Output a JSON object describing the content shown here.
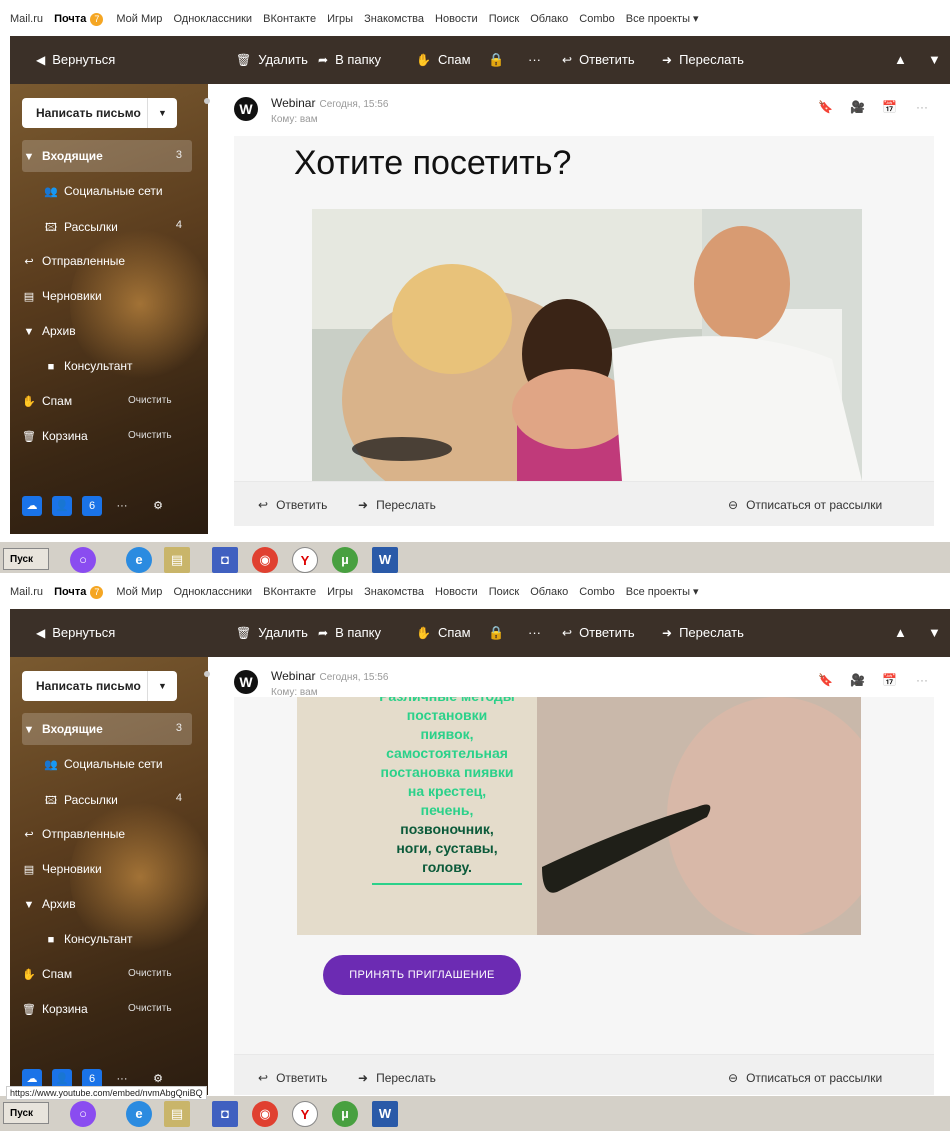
{
  "portal": {
    "items": [
      "Mail.ru",
      "Почта",
      "Мой Мир",
      "Одноклассники",
      "ВКонтакте",
      "Игры",
      "Знакомства",
      "Новости",
      "Поиск",
      "Облако",
      "Combo",
      "Все проекты ▾"
    ],
    "mail_badge": "7"
  },
  "toolbar": {
    "back": "Вернуться",
    "delete": "Удалить",
    "to_folder": "В папку",
    "spam": "Спам",
    "more": "···",
    "reply": "Ответить",
    "forward": "Переслать"
  },
  "sidebar": {
    "compose": "Написать письмо",
    "folders": [
      {
        "label": "Входящие",
        "count": "3",
        "icon": "triangle-down-icon"
      },
      {
        "label": "Социальные сети",
        "count": "",
        "icon": "people-icon"
      },
      {
        "label": "Рассылки",
        "count": "4",
        "icon": "newsletter-icon"
      },
      {
        "label": "Отправленные",
        "count": "",
        "icon": "sent-icon"
      },
      {
        "label": "Черновики",
        "count": "",
        "icon": "draft-icon"
      },
      {
        "label": "Архив",
        "count": "",
        "icon": "triangle-down-icon"
      },
      {
        "label": "Консультант",
        "count": "",
        "icon": "folder-icon"
      },
      {
        "label": "Спам",
        "count": "",
        "clear": "Очистить",
        "icon": "thumbs-down-icon"
      },
      {
        "label": "Корзина",
        "count": "",
        "clear": "Очистить",
        "icon": "trash-icon"
      }
    ],
    "calendar_day": "6"
  },
  "message": {
    "avatar_letter": "W",
    "sender": "Webinar",
    "date": "Сегодня, 15:56",
    "to": "Кому: вам",
    "heading": "Хотите посетить?",
    "overlay_lines": [
      "Различные методы",
      "постановки",
      "пиявок,",
      "самостоятельная",
      "постановка пиявки",
      "на крестец,",
      "печень,",
      "позвоночник,",
      "ноги, суставы,",
      "голову."
    ],
    "cta": "ПРИНЯТЬ ПРИГЛАШЕНИЕ"
  },
  "footer": {
    "reply": "Ответить",
    "forward": "Переслать",
    "unsubscribe": "Отписаться от рассылки"
  },
  "taskbar": {
    "start": "Пуск"
  },
  "status_url": "https://www.youtube.com/embed/nvmAbgQniBQ",
  "colors": {
    "toolbar": "#3b3028",
    "cta": "#6c2bb3",
    "badge": "#f5a623"
  }
}
